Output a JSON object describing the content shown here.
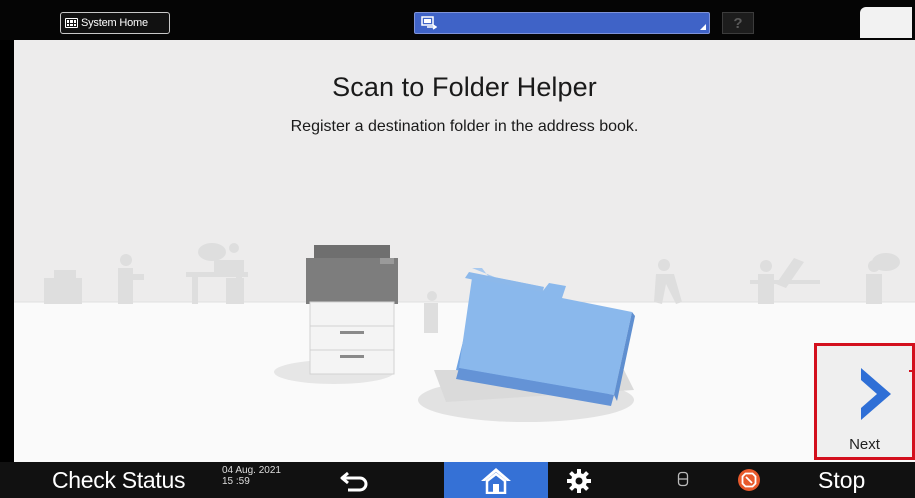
{
  "topbar": {
    "system_home_label": "System Home",
    "help_label": "?"
  },
  "main": {
    "title": "Scan to Folder Helper",
    "subtitle": "Register a destination folder in the address book.",
    "next_label": "Next"
  },
  "bottombar": {
    "check_status_label": "Check Status",
    "date": "04 Aug. 2021",
    "time": "15 :59",
    "stop_label": "Stop"
  },
  "colors": {
    "accent_blue": "#3571d6",
    "highlight_red": "#d3101d",
    "folder_blue": "#7fb0e6"
  },
  "icons": [
    "grid-icon",
    "scanner-app-icon",
    "help-icon",
    "moon-icon",
    "chevron-right-icon",
    "back-arrow-icon",
    "home-icon",
    "gear-icon",
    "storage-icon",
    "stop-icon"
  ]
}
